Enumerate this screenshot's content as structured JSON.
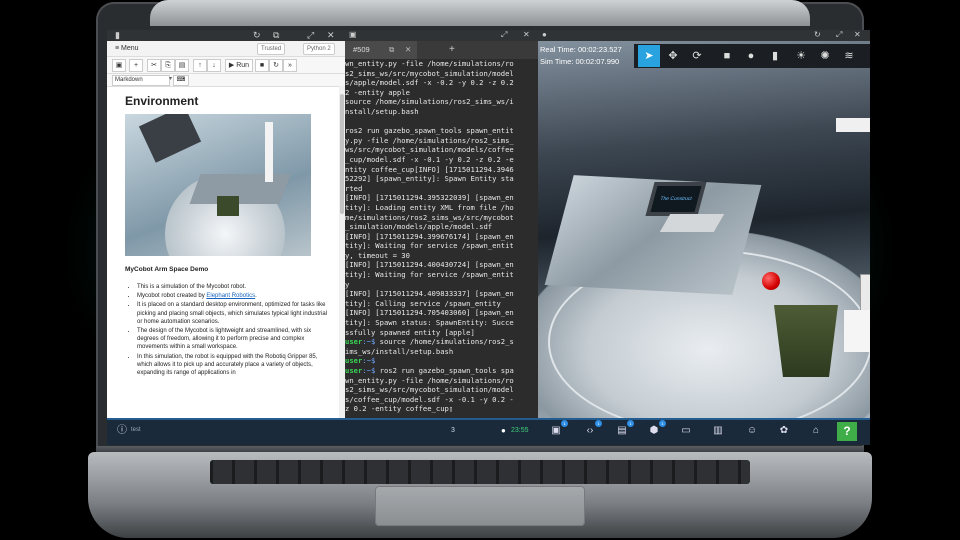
{
  "notebook": {
    "menu_label": "≡ Menu",
    "trusted_label": "Trusted",
    "kernel_label": "Python 2",
    "run_label": "▶ Run",
    "cell_type": "Markdown",
    "heading": "Environment",
    "subheading": "MyCobot Arm Space Demo",
    "bullets": [
      {
        "text": "This is a simulation of the Mycobot robot."
      },
      {
        "text": "Mycobot robot created by ",
        "link": "Elephant Robotics",
        "after": "."
      },
      {
        "text": "It is placed on a standard desktop environment, optimized for tasks like picking and placing small objects, which simulates typical light industrial or home automation scenarios."
      },
      {
        "text": "The design of the Mycobot is lightweight and streamlined, with six degrees of freedom, allowing it to perform precise and complex movements within a small workspace."
      },
      {
        "text": "In this simulation, the robot is equipped with the Robotiq Gripper 85, which allows it to pick up and accurately place a variety of objects, expanding its range of applications in"
      }
    ]
  },
  "terminal": {
    "tab_label": "#509",
    "add_tab": "+",
    "lines": [
      {
        "t": "wn_entity.py -file /home/simulations/ro"
      },
      {
        "t": "s2_sims_ws/src/mycobot_simulation/model"
      },
      {
        "t": "s/apple/model.sdf -x -0.2 -y 0.2 -z 0.2"
      },
      {
        "t": "2 -entity apple"
      },
      {
        "t": "source /home/simulations/ros2_sims_ws/i"
      },
      {
        "t": "nstall/setup.bash"
      },
      {
        "t": ""
      },
      {
        "t": "ros2 run gazebo_spawn_tools spawn_entit"
      },
      {
        "t": "y.py -file /home/simulations/ros2_sims_"
      },
      {
        "t": "ws/src/mycobot_simulation/models/coffee"
      },
      {
        "t": "_cup/model.sdf -x -0.1 -y 0.2 -z 0.2 -e"
      },
      {
        "t": "ntity coffee_cup[INFO] [1715011294.3946"
      },
      {
        "t": "52292] [spawn_entity]: Spawn Entity sta"
      },
      {
        "t": "rted"
      },
      {
        "t": "[INFO] [1715011294.395322039] [spawn_en"
      },
      {
        "t": "tity]: Loading entity XML from file /ho"
      },
      {
        "t": "me/simulations/ros2_sims_ws/src/mycobot"
      },
      {
        "t": "_simulation/models/apple/model.sdf"
      },
      {
        "t": "[INFO] [1715011294.399676174] [spawn_en"
      },
      {
        "t": "tity]: Waiting for service /spawn_entit"
      },
      {
        "t": "y, timeout = 30"
      },
      {
        "t": "[INFO] [1715011294.400430724] [spawn_en"
      },
      {
        "t": "tity]: Waiting for service /spawn_entit"
      },
      {
        "t": "y"
      },
      {
        "t": "[INFO] [1715011294.409833337] [spawn_en"
      },
      {
        "t": "tity]: Calling service /spawn_entity"
      },
      {
        "t": "[INFO] [1715011294.705403060] [spawn_en"
      },
      {
        "t": "tity]: Spawn status: SpawnEntity: Succe"
      },
      {
        "t": "ssfully spawned entity [apple]"
      },
      {
        "p": "user",
        "c": ":~$",
        "t": " source /home/simulations/ros2_s"
      },
      {
        "t": "ims_ws/install/setup.bash"
      },
      {
        "p": "user",
        "c": ":~$",
        "t": ""
      },
      {
        "p": "user",
        "c": ":~$",
        "t": " ros2 run gazebo_spawn_tools spa"
      },
      {
        "t": "wn_entity.py -file /home/simulations/ro"
      },
      {
        "t": "s2_sims_ws/src/mycobot_simulation/model"
      },
      {
        "t": "s/coffee_cup/model.sdf -x -0.1 -y 0.2 -"
      },
      {
        "t": "z 0.2 -entity coffee_cup▯"
      }
    ]
  },
  "sim": {
    "real_time_label": "Real Time:",
    "real_time": "00:02:23.527",
    "sim_time_label": "Sim Time:",
    "sim_time": "00:02:07.990",
    "laptop_screen_text": "The Construct"
  },
  "taskbar": {
    "info_label": "test",
    "page_num": "3",
    "clock": "23:55",
    "help_label": "?",
    "colors": {
      "accent": "#2f8ee6",
      "help": "#3fae49"
    }
  },
  "icons": [
    "menu-icon",
    "save-icon",
    "add-cell-icon",
    "cut-icon",
    "copy-icon",
    "paste-icon",
    "arrow-up-icon",
    "arrow-down-icon",
    "run-icon",
    "stop-icon",
    "restart-icon",
    "fast-forward-icon",
    "keyboard-icon",
    "refresh-icon",
    "popout-icon",
    "maximize-icon",
    "close-icon",
    "select-cursor-icon",
    "move-icon",
    "rotate-icon",
    "box-icon",
    "sphere-icon",
    "cylinder-icon",
    "sun-icon",
    "point-light-icon",
    "spot-light-icon",
    "info-icon",
    "terminal-icon",
    "code-icon",
    "file-icon",
    "cube-icon",
    "monitor-icon",
    "book-icon",
    "robot-icon",
    "openai-icon",
    "home-icon",
    "help-icon"
  ]
}
